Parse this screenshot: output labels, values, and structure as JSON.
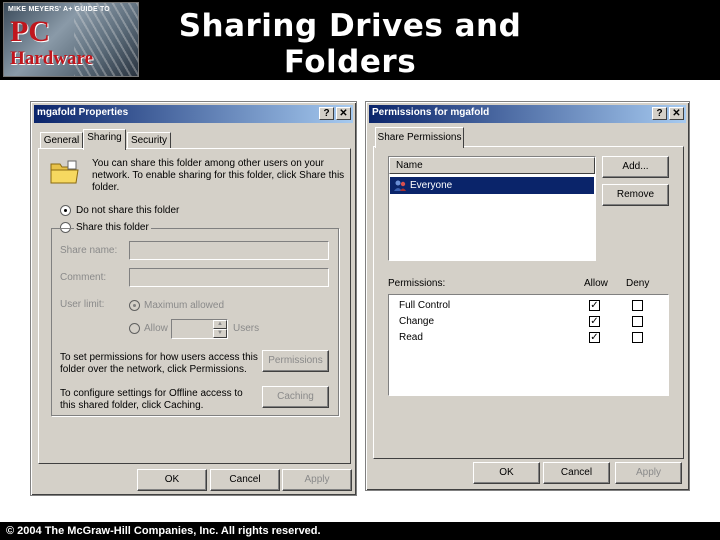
{
  "slide": {
    "title_line1": "Sharing Drives and",
    "title_line2": "Folders",
    "logo": {
      "top_text": "MIKE MEYERS' A+ GUIDE TO",
      "line1": "PC",
      "line2": "Hardware"
    },
    "copyright": "© 2004 The McGraw-Hill Companies, Inc. All rights reserved."
  },
  "properties": {
    "title": "mgafold Properties",
    "help_btn": "?",
    "close_btn": "✕",
    "tabs": [
      "General",
      "Sharing",
      "Security"
    ],
    "description": [
      "You can share this folder among other users on your",
      "network. To enable sharing for this folder, click Share this",
      "folder."
    ],
    "radio_no_share": "Do not share this folder",
    "radio_share": "Share this folder",
    "share_name_label": "Share name:",
    "comment_label": "Comment:",
    "user_limit_label": "User limit:",
    "max_allowed": "Maximum allowed",
    "allow": "Allow",
    "users": "Users",
    "perm_text": [
      "To set permissions for how users access this",
      "folder over the network, click Permissions."
    ],
    "perm_btn": "Permissions",
    "cache_text": [
      "To configure settings for Offline access to",
      "this shared folder, click Caching."
    ],
    "cache_btn": "Caching",
    "ok": "OK",
    "cancel": "Cancel",
    "apply": "Apply"
  },
  "permissions": {
    "title": "Permissions for mgafold",
    "help_btn": "?",
    "close_btn": "✕",
    "tab": "Share Permissions",
    "name_header": "Name",
    "names": [
      "Everyone"
    ],
    "add_btn": "Add...",
    "remove_btn": "Remove",
    "perm_label": "Permissions:",
    "allow_header": "Allow",
    "deny_header": "Deny",
    "rows": [
      {
        "name": "Full Control",
        "allow": true,
        "deny": false
      },
      {
        "name": "Change",
        "allow": true,
        "deny": false
      },
      {
        "name": "Read",
        "allow": true,
        "deny": false
      }
    ],
    "ok": "OK",
    "cancel": "Cancel",
    "apply": "Apply"
  },
  "colors": {
    "titlebar_start": "#0a246a",
    "titlebar_end": "#a6caf0",
    "dialog_face": "#d4d0c8",
    "selection": "#0a246a"
  }
}
